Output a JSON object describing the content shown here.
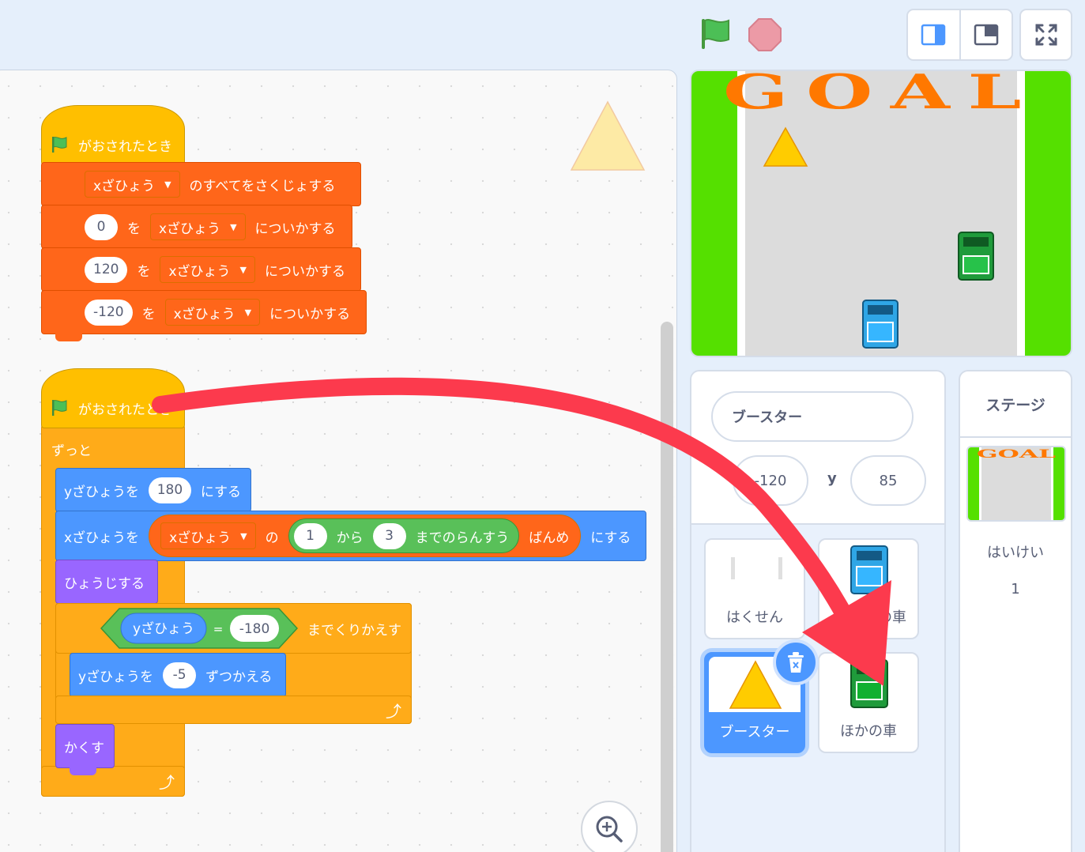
{
  "blocks": {
    "hat_label": "がおされたとき",
    "script1": {
      "delete_all_pre": "",
      "var_name": "xざひょう",
      "delete_all_post": "のすべてをさくじょする",
      "add_values": [
        "0",
        "120",
        "-120"
      ],
      "add_wo": "を",
      "add_post": "についかする"
    },
    "script2": {
      "forever": "ずっと",
      "set_y_label": "yざひょうを",
      "set_y_value": "180",
      "set_suffix": "にする",
      "set_x_label": "xざひょうを",
      "list_name": "xざひょう",
      "no": "の",
      "rand_from": "1",
      "kara": "から",
      "rand_to": "3",
      "rand_suffix": "までのらんすう",
      "item_suffix": "ばんめ",
      "show": "ひょうじする",
      "ypos_reporter": "yざひょう",
      "equals": "=",
      "cmp_value": "-180",
      "repeat_until": "までくりかえす",
      "change_y_label": "yざひょうを",
      "change_y_value": "-5",
      "change_suffix": "ずつかえる",
      "hide": "かくす"
    }
  },
  "stage": {
    "goal_text": "GOAL"
  },
  "sprite_info": {
    "name": "ブースター",
    "x": "-120",
    "y_label": "y",
    "y": "85"
  },
  "sprites": [
    {
      "name": "はくせん"
    },
    {
      "name": "じぶんの車",
      "visible_name": "の車"
    },
    {
      "name": "ブースター",
      "selected": true
    },
    {
      "name": "ほかの車"
    }
  ],
  "stage_selector": {
    "header": "ステージ",
    "backdrops_label": "はいけい",
    "backdrops_count": "1"
  },
  "colors": {
    "event": "#ffbf00",
    "variables_list": "#ff661a",
    "control": "#ffab19",
    "motion": "#4c97ff",
    "looks": "#9966ff",
    "operators": "#59c059",
    "annotation_arrow": "#fc3a4d"
  },
  "icons": [
    "green-flag-icon",
    "stop-icon",
    "small-stage-icon",
    "large-stage-icon",
    "fullscreen-icon",
    "zoom-in-icon",
    "delete-icon",
    "loop-arrow-icon"
  ]
}
